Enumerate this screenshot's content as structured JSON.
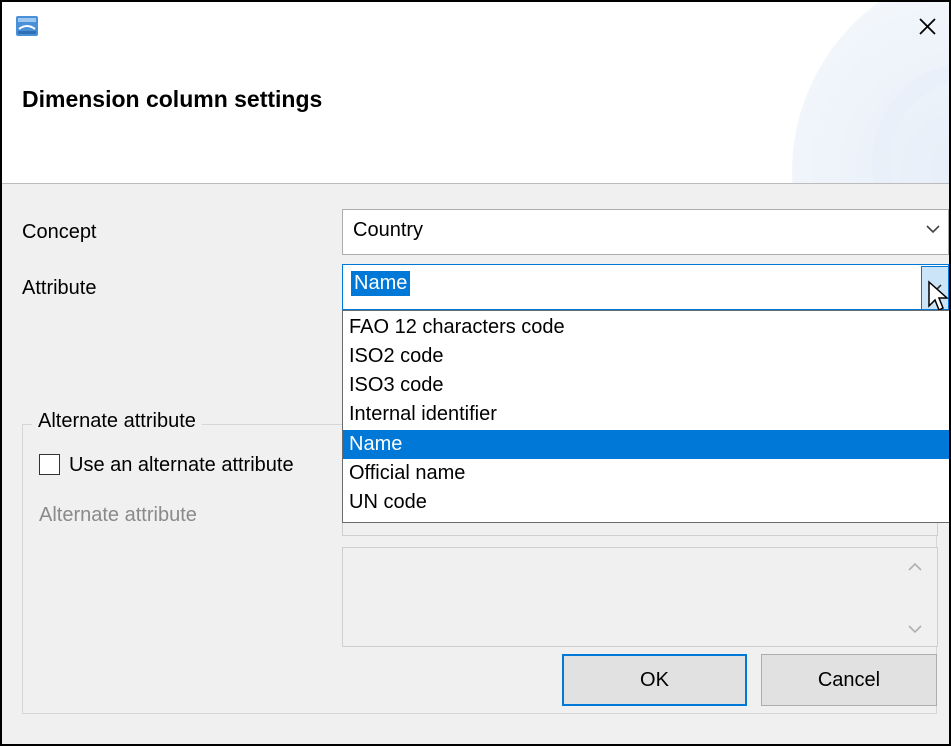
{
  "window": {
    "title": "Dimension column settings"
  },
  "form": {
    "concept_label": "Concept",
    "concept_value": "Country",
    "attribute_label": "Attribute",
    "attribute_value": "Name"
  },
  "dropdown": {
    "options": [
      "FAO 12 characters code",
      "ISO2 code",
      "ISO3 code",
      "Internal identifier",
      "Name",
      "Official name",
      "UN code"
    ],
    "selected": "Name"
  },
  "alternate": {
    "group_label": "Alternate attribute",
    "checkbox_label": "Use an alternate attribute",
    "field_label": "Alternate attribute"
  },
  "buttons": {
    "ok": "OK",
    "cancel": "Cancel"
  },
  "colors": {
    "accent": "#0078d7",
    "selection_bg": "#0078d7",
    "dialog_bg": "#f0f0f0",
    "drop_button_bg": "#cce4f7"
  },
  "icons": {
    "app": "app-window-icon",
    "close": "close-icon",
    "dropdown": "chevron-down-icon",
    "scroll_up": "chevron-up-icon",
    "scroll_down": "chevron-down-icon"
  }
}
